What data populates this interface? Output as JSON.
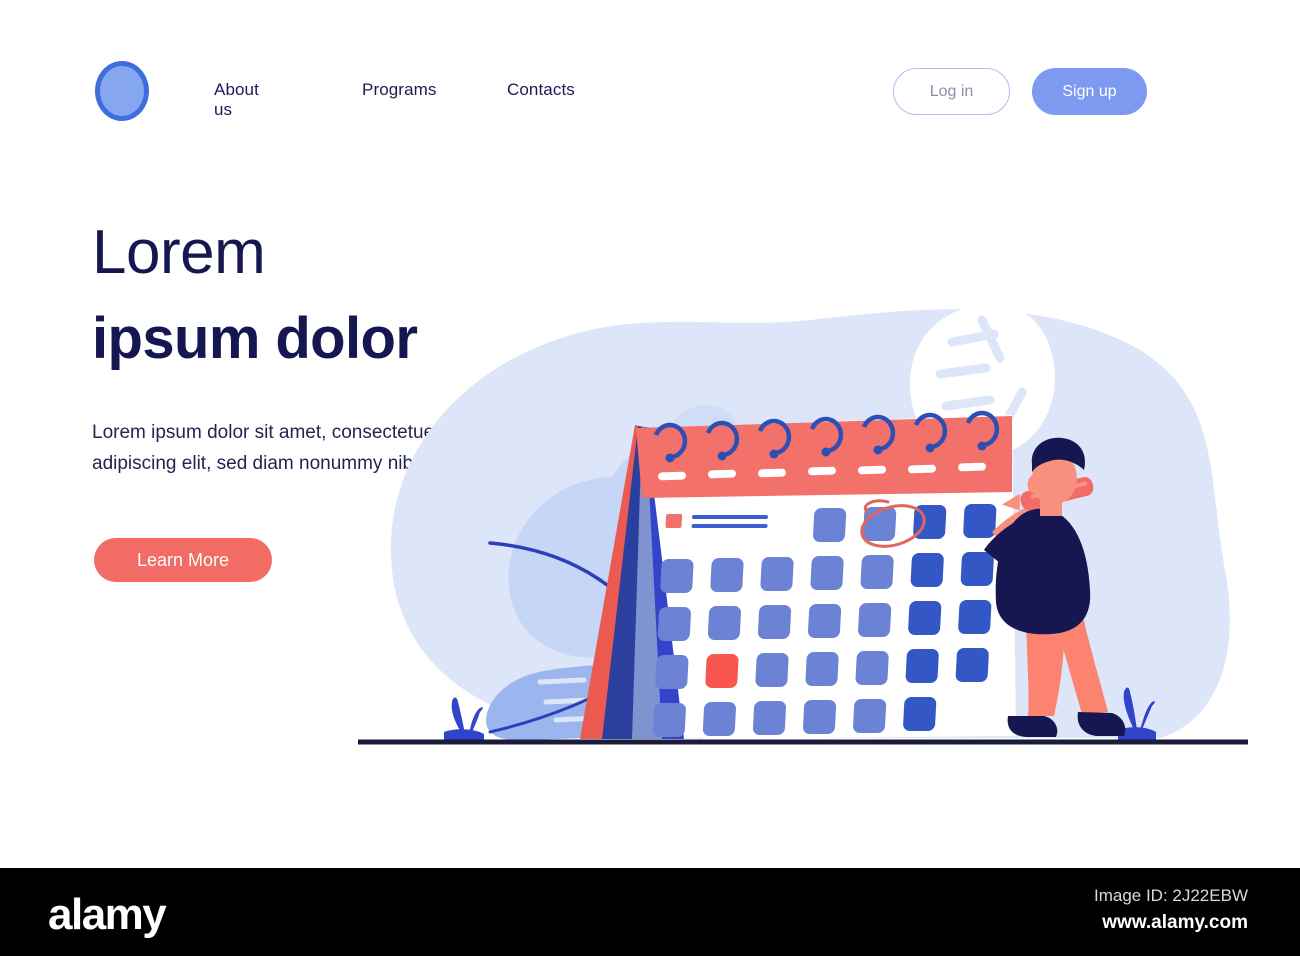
{
  "header": {
    "logo_icon": "circle-logo-icon",
    "nav": [
      {
        "label": "About us"
      },
      {
        "label": "Programs"
      },
      {
        "label": "Contacts"
      }
    ],
    "login_label": "Log in",
    "signup_label": "Sign up"
  },
  "hero": {
    "title_line1": "Lorem",
    "title_line2": "ipsum dolor",
    "subtitle": "Lorem ipsum dolor sit amet, consectetuer adipiscing elit, sed diam nonummy nibh",
    "cta_label": "Learn More"
  },
  "illustration": {
    "name": "calendar-planning-illustration",
    "calendar": {
      "header_color": "#f2716a",
      "body_color": "#ffffff",
      "ring_color": "#2d4fb5",
      "dash_color": "#ffffff",
      "ring_count": 7,
      "dash_count": 7,
      "cell_color": "#6c82d4",
      "cell_color_dark": "#3358c5",
      "highlight_cell_color": "#f9564f",
      "circle_annotation_color": "#e0675f",
      "legend_square_color": "#f2716a",
      "legend_line_color": "#3b5fd0",
      "page_stack_colors": [
        "#ea5a51",
        "#2b3f9e",
        "#7e93cf",
        "#3244c9"
      ]
    },
    "character": {
      "hair_color": "#161651",
      "skin_color": "#f7917e",
      "sweater_color": "#161651",
      "pants_color": "#fb8370",
      "shoe_color": "#161651",
      "pencil_color": "#f26b65"
    },
    "background": {
      "blob_color": "#dde6f8",
      "leaf_color_light": "#c6d6f6",
      "leaf_color_mid": "#9bb5ef",
      "leaf_color_white": "#ffffff",
      "stem_color": "#2d3fb8",
      "grass_color": "#3244c9",
      "ground_line_color": "#1b1b3a"
    }
  },
  "watermark": {
    "logo": "alamy",
    "image_id": "Image ID: 2J22EBW",
    "url": "www.alamy.com"
  }
}
